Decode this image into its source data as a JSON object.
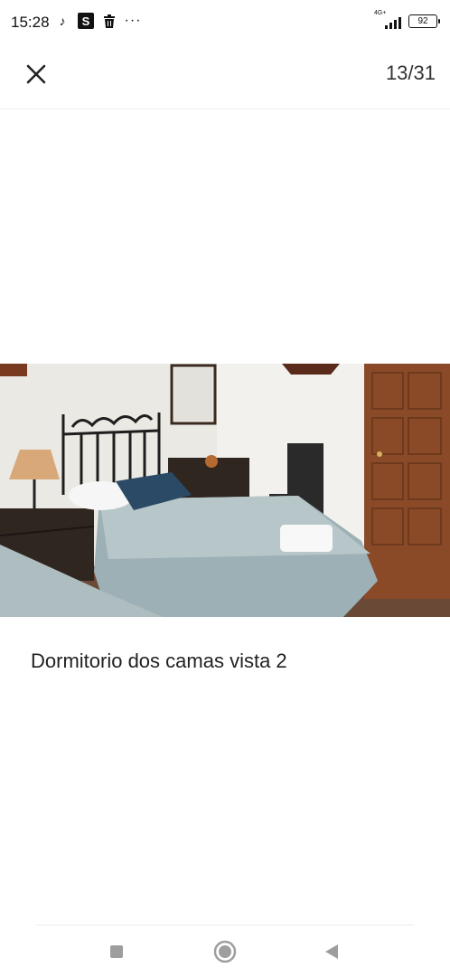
{
  "status_bar": {
    "time": "15:28",
    "network": "4G+",
    "battery": "92",
    "left_icons": [
      "tiktok-icon",
      "s-app-icon",
      "trash-icon",
      "more-dots-icon"
    ]
  },
  "header": {
    "close_icon": "close-icon",
    "counter": "13/31"
  },
  "photo": {
    "caption": "Dormitorio dos camas vista 2"
  },
  "nav": {
    "icons": [
      "recents-square-icon",
      "home-circle-icon",
      "back-triangle-icon"
    ]
  },
  "colors": {
    "background": "#ffffff",
    "text": "#222222",
    "nav_icon": "#9e9e9e"
  }
}
